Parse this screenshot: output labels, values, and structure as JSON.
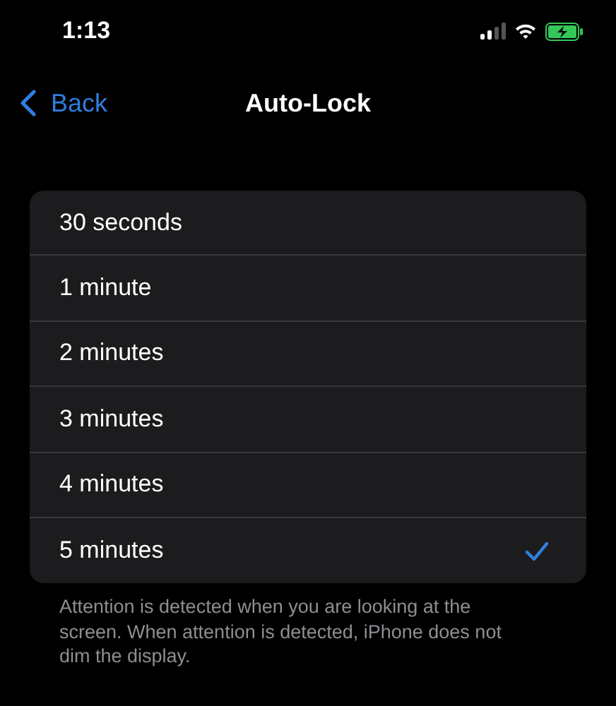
{
  "status_bar": {
    "time": "1:13",
    "charging": true
  },
  "nav": {
    "back": "Back",
    "title": "Auto-Lock"
  },
  "options": [
    {
      "label": "30 seconds",
      "selected": false
    },
    {
      "label": "1 minute",
      "selected": false
    },
    {
      "label": "2 minutes",
      "selected": false
    },
    {
      "label": "3 minutes",
      "selected": false
    },
    {
      "label": "4 minutes",
      "selected": false
    },
    {
      "label": "5 minutes",
      "selected": true
    }
  ],
  "footer": "Attention is detected when you are looking at the screen. When attention is detected, iPhone does not dim the display."
}
